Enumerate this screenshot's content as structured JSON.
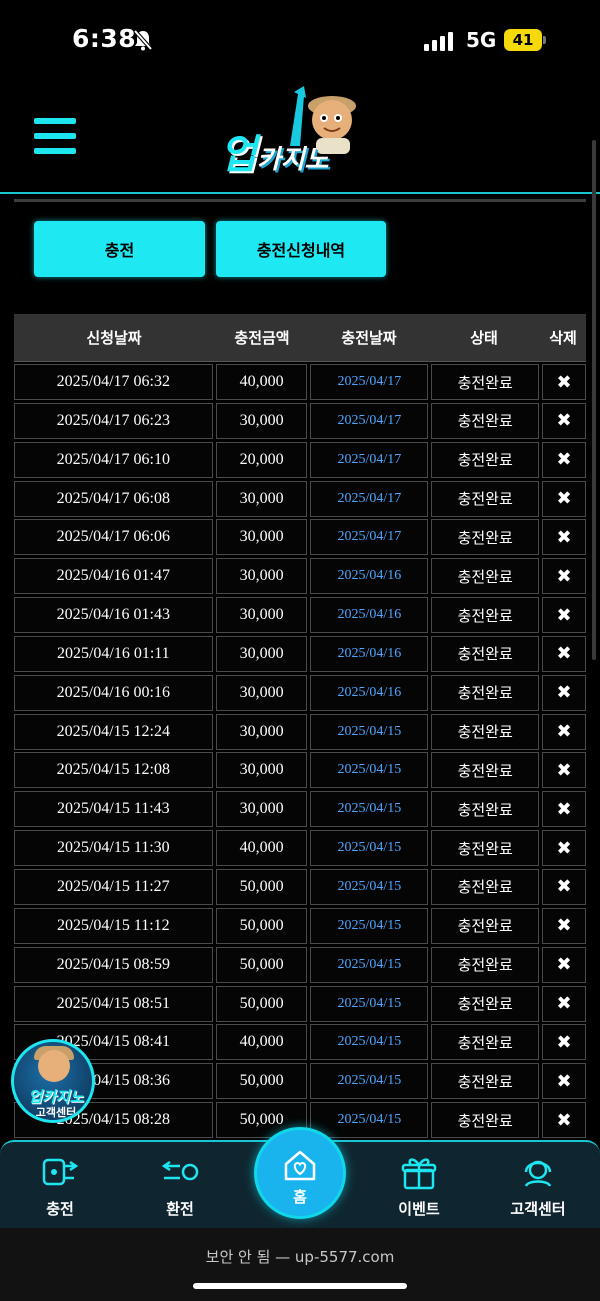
{
  "status_bar": {
    "time": "6:38",
    "network": "5G",
    "battery": "41"
  },
  "header": {
    "logo_main": "업",
    "logo_sub": "카지노"
  },
  "tabs": {
    "charge": "충전",
    "history": "충전신청내역"
  },
  "table": {
    "headers": [
      "신청날짜",
      "충전금액",
      "충전날짜",
      "상태",
      "삭제"
    ],
    "rows": [
      {
        "requested": "2025/04/17 06:32",
        "amount": "40,000",
        "charged": "2025/04/17",
        "status": "충전완료"
      },
      {
        "requested": "2025/04/17 06:23",
        "amount": "30,000",
        "charged": "2025/04/17",
        "status": "충전완료"
      },
      {
        "requested": "2025/04/17 06:10",
        "amount": "20,000",
        "charged": "2025/04/17",
        "status": "충전완료"
      },
      {
        "requested": "2025/04/17 06:08",
        "amount": "30,000",
        "charged": "2025/04/17",
        "status": "충전완료"
      },
      {
        "requested": "2025/04/17 06:06",
        "amount": "30,000",
        "charged": "2025/04/17",
        "status": "충전완료"
      },
      {
        "requested": "2025/04/16 01:47",
        "amount": "30,000",
        "charged": "2025/04/16",
        "status": "충전완료"
      },
      {
        "requested": "2025/04/16 01:43",
        "amount": "30,000",
        "charged": "2025/04/16",
        "status": "충전완료"
      },
      {
        "requested": "2025/04/16 01:11",
        "amount": "30,000",
        "charged": "2025/04/16",
        "status": "충전완료"
      },
      {
        "requested": "2025/04/16 00:16",
        "amount": "30,000",
        "charged": "2025/04/16",
        "status": "충전완료"
      },
      {
        "requested": "2025/04/15 12:24",
        "amount": "30,000",
        "charged": "2025/04/15",
        "status": "충전완료"
      },
      {
        "requested": "2025/04/15 12:08",
        "amount": "30,000",
        "charged": "2025/04/15",
        "status": "충전완료"
      },
      {
        "requested": "2025/04/15 11:43",
        "amount": "30,000",
        "charged": "2025/04/15",
        "status": "충전완료"
      },
      {
        "requested": "2025/04/15 11:30",
        "amount": "40,000",
        "charged": "2025/04/15",
        "status": "충전완료"
      },
      {
        "requested": "2025/04/15 11:27",
        "amount": "50,000",
        "charged": "2025/04/15",
        "status": "충전완료"
      },
      {
        "requested": "2025/04/15 11:12",
        "amount": "50,000",
        "charged": "2025/04/15",
        "status": "충전완료"
      },
      {
        "requested": "2025/04/15 08:59",
        "amount": "50,000",
        "charged": "2025/04/15",
        "status": "충전완료"
      },
      {
        "requested": "2025/04/15 08:51",
        "amount": "50,000",
        "charged": "2025/04/15",
        "status": "충전완료"
      },
      {
        "requested": "2025/04/15 08:41",
        "amount": "40,000",
        "charged": "2025/04/15",
        "status": "충전완료"
      },
      {
        "requested": "2025/04/15 08:36",
        "amount": "50,000",
        "charged": "2025/04/15",
        "status": "충전완료"
      },
      {
        "requested": "2025/04/15 08:28",
        "amount": "50,000",
        "charged": "2025/04/15",
        "status": "충전완료"
      }
    ],
    "delete_glyph": "✖"
  },
  "cs_badge": {
    "title": "업카지노",
    "subtitle": "고객센터"
  },
  "bottom_nav": {
    "charge": "충전",
    "exchange": "환전",
    "home": "홈",
    "event": "이벤트",
    "support": "고객센터"
  },
  "browser": {
    "url_text": "보안 안 됨 — up-5577.com"
  },
  "colors": {
    "accent": "#1ee6f0",
    "link_date": "#4ea6ff",
    "nav_bg": "#0f2630",
    "home_btn": "#19b4ee"
  }
}
